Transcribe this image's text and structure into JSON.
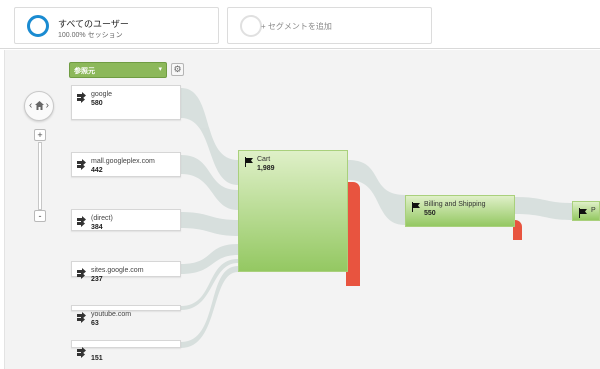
{
  "segments": {
    "primary": {
      "title": "すべてのユーザー",
      "subtitle": "100.00% セッション"
    },
    "add": {
      "label": "+ セグメントを追加"
    }
  },
  "colors": {
    "segment_ring": "#1a8bd1",
    "node_green": "#94c862",
    "dropoff_red": "#e8543f",
    "dropdown_green": "#8cb85a"
  },
  "toolbar": {
    "dimension_label": "参照元",
    "caret": "▾",
    "gear": "⚙"
  },
  "navigation": {
    "left": "‹",
    "right": "›",
    "zoom_in": "+",
    "zoom_out": "-"
  },
  "sources": [
    {
      "name": "google",
      "value": "580"
    },
    {
      "name": "mall.googleplex.com",
      "value": "442"
    },
    {
      "name": "(direct)",
      "value": "384"
    },
    {
      "name": "sites.google.com",
      "value": "237"
    },
    {
      "name": "youtube.com",
      "value": "63"
    },
    {
      "name": "",
      "value": "151"
    }
  ],
  "steps": [
    {
      "name": "Cart",
      "value": "1,989"
    },
    {
      "name": "Billing and Shipping",
      "value": "550"
    },
    {
      "name": "P",
      "value": ""
    }
  ]
}
